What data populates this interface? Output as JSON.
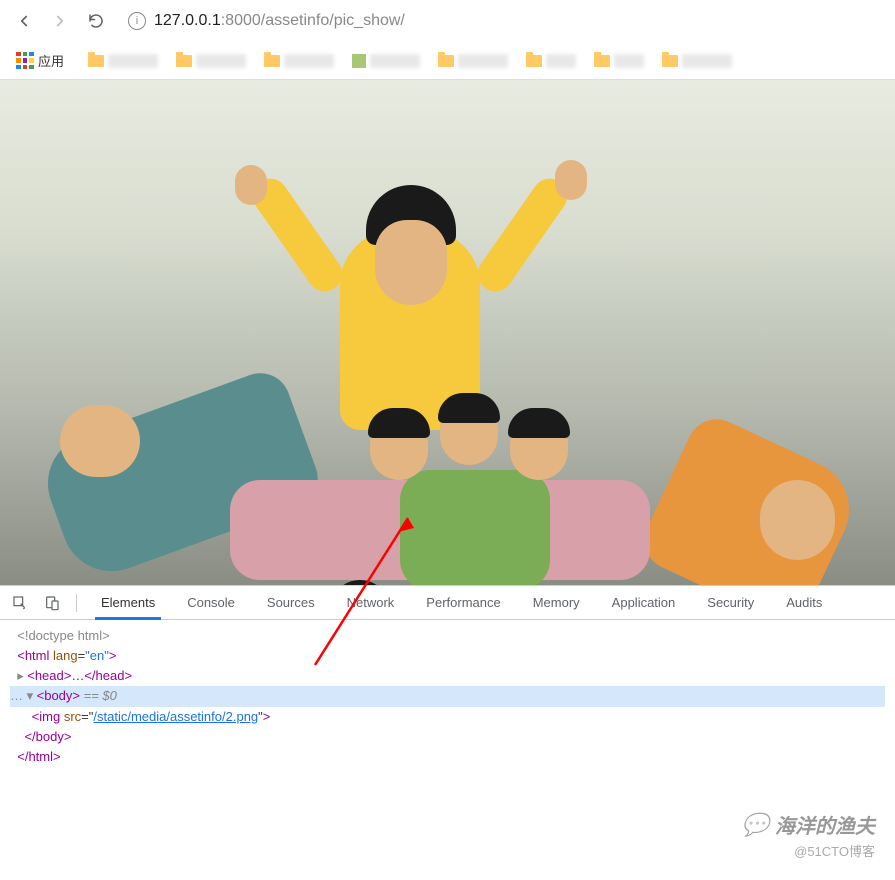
{
  "toolbar": {
    "url_host": "127.0.0.1",
    "url_port": ":8000",
    "url_path": "/assetinfo/pic_show/"
  },
  "bookmarks": {
    "apps_label": "应用"
  },
  "devtools": {
    "tabs": {
      "elements": "Elements",
      "console": "Console",
      "sources": "Sources",
      "network": "Network",
      "performance": "Performance",
      "memory": "Memory",
      "application": "Application",
      "security": "Security",
      "audits": "Audits"
    },
    "source": {
      "doctype": "<!doctype html>",
      "html_open_pre": "<html ",
      "lang_attr": "lang",
      "lang_val": "\"en\"",
      "html_open_post": ">",
      "head_open": "<head>",
      "head_ellipsis": "…",
      "head_close": "</head>",
      "body_open": "<body>",
      "eq0": " == $0",
      "img_pre": "<img ",
      "src_attr": "src",
      "src_val": "/static/media/assetinfo/2.png",
      "img_post": ">",
      "body_close": "</body>",
      "html_close": "</html>"
    }
  },
  "watermark": {
    "title": "海洋的渔夫",
    "subtitle": "@51CTO博客"
  }
}
